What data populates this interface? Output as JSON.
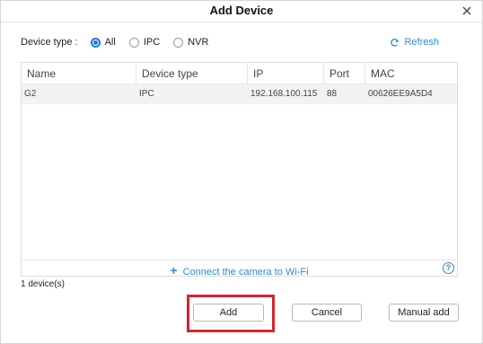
{
  "dialog": {
    "title": "Add Device"
  },
  "filter": {
    "label": "Device type :",
    "options": [
      {
        "label": "All",
        "selected": true
      },
      {
        "label": "IPC",
        "selected": false
      },
      {
        "label": "NVR",
        "selected": false
      }
    ]
  },
  "refresh_label": "Refresh",
  "table": {
    "columns": [
      "Name",
      "Device type",
      "IP",
      "Port",
      "MAC"
    ],
    "rows": [
      {
        "name": "G2",
        "device_type": "IPC",
        "ip": "192.168.100.115",
        "port": "88",
        "mac": "00626EE9A5D4"
      }
    ]
  },
  "wifi_link": {
    "plus": "+",
    "label": "Connect the camera to Wi-Fi"
  },
  "help_icon": "?",
  "device_count": "1 device(s)",
  "buttons": {
    "add": "Add",
    "cancel": "Cancel",
    "manual_add": "Manual add"
  },
  "colors": {
    "accent": "#1f78d1",
    "link": "#2a8ad8",
    "highlight": "#d7252b"
  }
}
